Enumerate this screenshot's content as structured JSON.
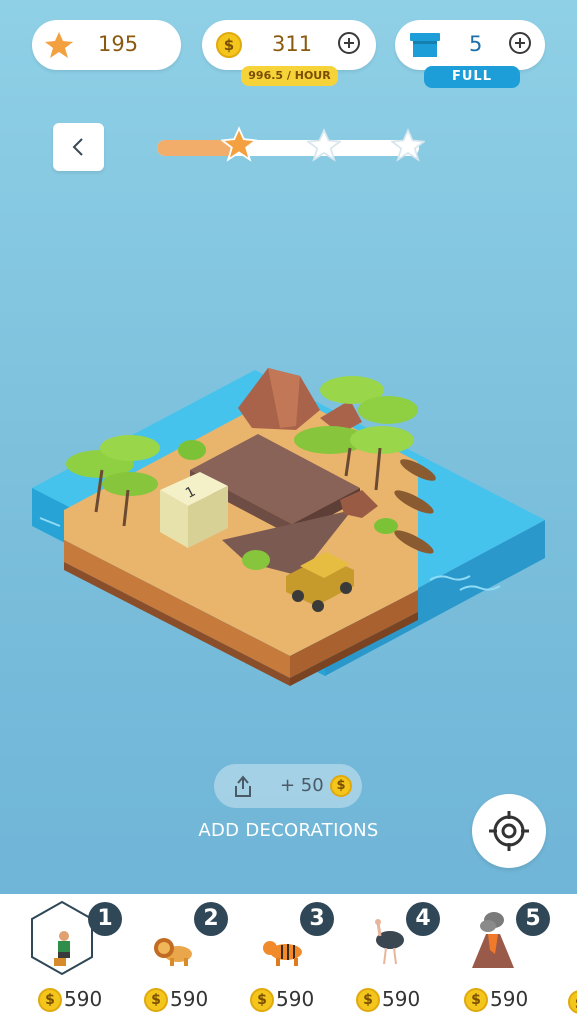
{
  "hud": {
    "stars": "195",
    "coins": "311",
    "rate": "996.5 / HOUR",
    "coin_symbol": "$",
    "boxes": "5",
    "box_status": "FULL"
  },
  "level": {
    "progress": 0.31,
    "stars_total": 3,
    "stars_earned": 1
  },
  "share": {
    "reward": "+ 50",
    "coin_symbol": "$"
  },
  "add_decorations": "ADD DECORATIONS",
  "shop": {
    "items": [
      {
        "number": "1",
        "price": "590",
        "icon": "hiker-icon",
        "selected": true
      },
      {
        "number": "2",
        "price": "590",
        "icon": "lion-icon"
      },
      {
        "number": "3",
        "price": "590",
        "icon": "tiger-icon"
      },
      {
        "number": "4",
        "price": "590",
        "icon": "ostrich-icon"
      },
      {
        "number": "5",
        "price": "590",
        "icon": "volcano-icon"
      }
    ]
  },
  "island": {
    "block_label": "1"
  },
  "colors": {
    "sky": "#7cc0dc",
    "sand": "#e8b36a",
    "water": "#3fb9e6",
    "accent_gold": "#f4c61c",
    "badge_dark": "#2f4756",
    "progress": "#f2ad6b",
    "full_badge": "#1e9ed8"
  }
}
